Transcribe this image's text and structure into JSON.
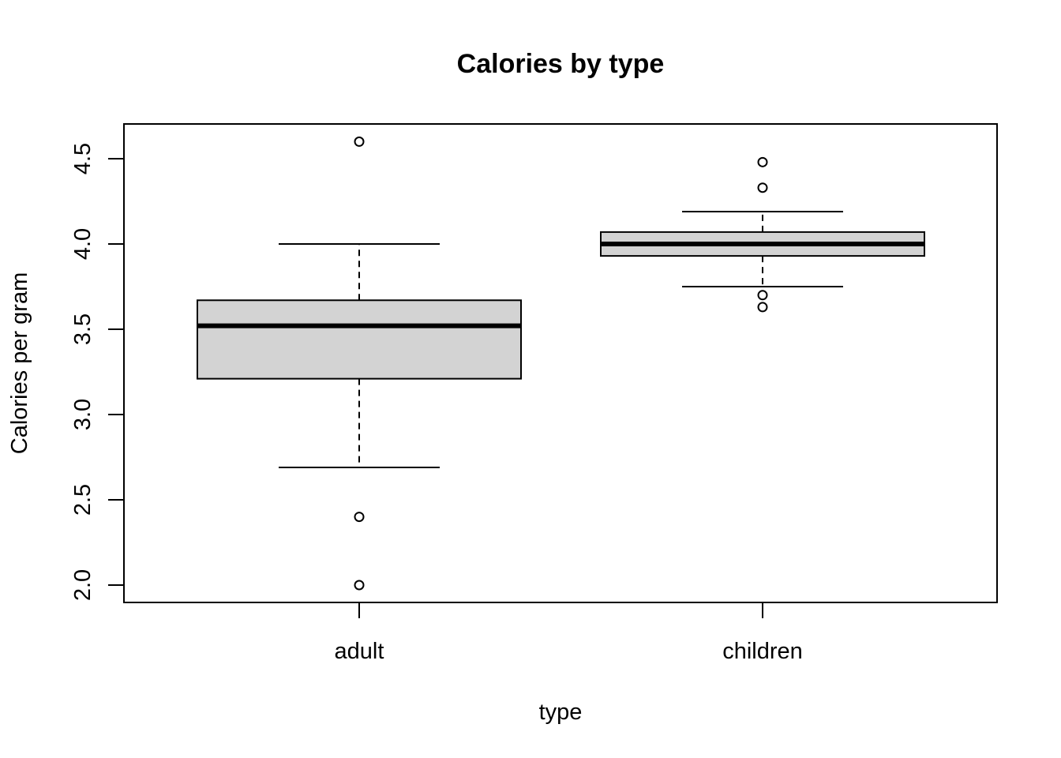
{
  "chart_data": {
    "type": "boxplot",
    "title": "Calories by type",
    "xlabel": "type",
    "ylabel": "Calories per gram",
    "categories": [
      "adult",
      "children"
    ],
    "ylim": [
      1.9,
      4.7
    ],
    "yticks": [
      2.0,
      2.5,
      3.0,
      3.5,
      4.0,
      4.5
    ],
    "ytick_labels": [
      "2.0",
      "2.5",
      "3.0",
      "3.5",
      "4.0",
      "4.5"
    ],
    "grid": false,
    "box_fill": "#d3d3d3",
    "boxes": [
      {
        "name": "adult",
        "whisker_low": 2.69,
        "q1": 3.21,
        "median": 3.52,
        "q3": 3.67,
        "whisker_high": 4.0,
        "outliers": [
          4.6,
          2.4,
          2.0
        ]
      },
      {
        "name": "children",
        "whisker_low": 3.75,
        "q1": 3.93,
        "median": 4.0,
        "q3": 4.07,
        "whisker_high": 4.19,
        "outliers": [
          4.48,
          4.33,
          3.7,
          3.63
        ]
      }
    ]
  }
}
